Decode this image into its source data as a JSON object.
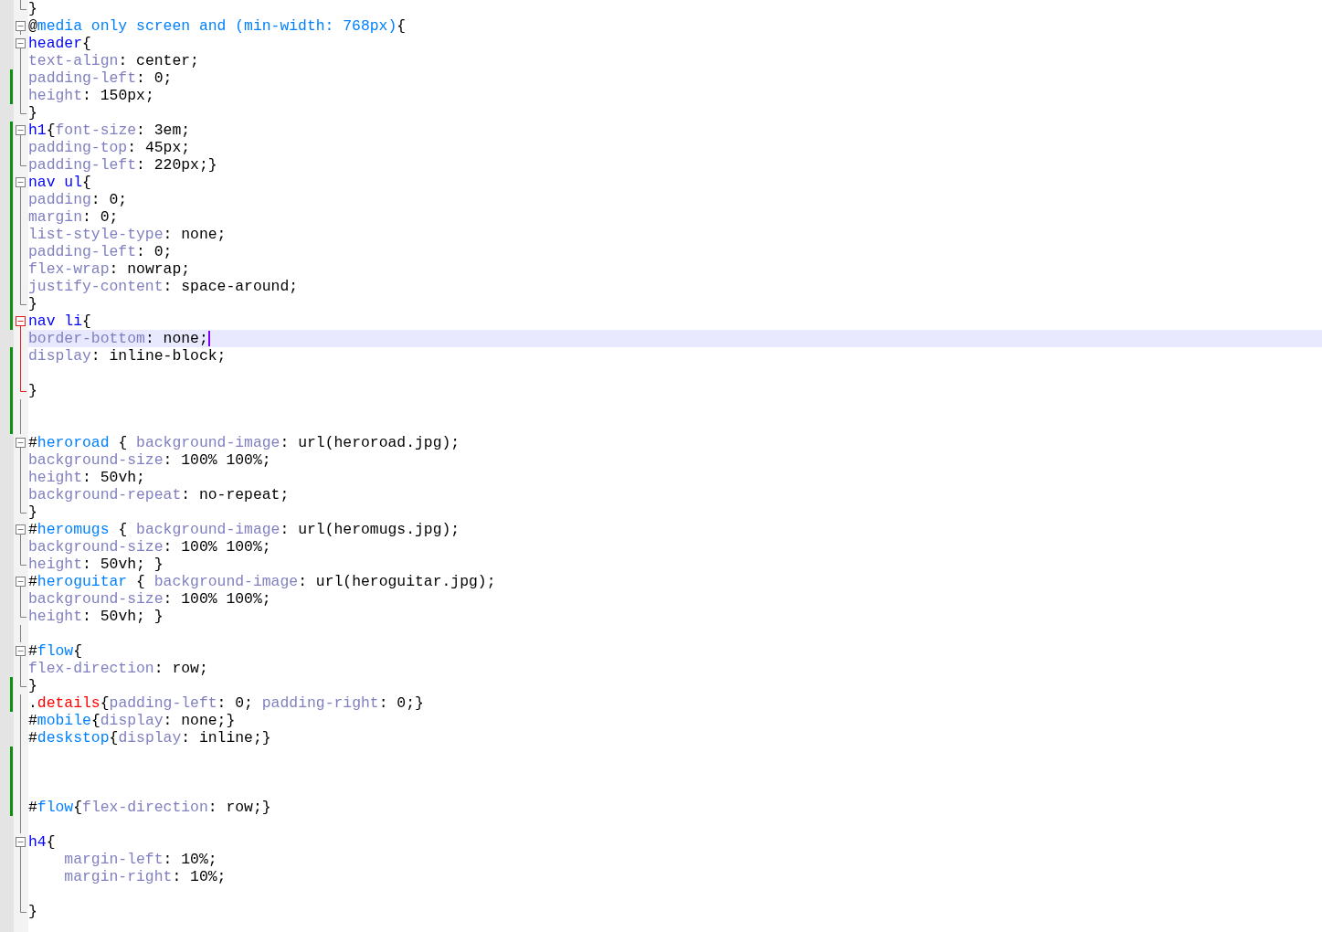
{
  "lines": [
    {
      "kind": "fold_end",
      "indented": false,
      "changed": false,
      "active_block": false,
      "current": false,
      "tokens": [
        {
          "text": "}",
          "kind": "punct"
        }
      ]
    },
    {
      "kind": "fold_start",
      "indented": false,
      "changed": false,
      "active_block": false,
      "current": false,
      "tokens": [
        {
          "text": "@",
          "kind": "punct"
        },
        {
          "text": "media only screen and (min-width: 768px)",
          "kind": "at"
        },
        {
          "text": "{",
          "kind": "punct"
        }
      ]
    },
    {
      "kind": "fold_start",
      "indented": false,
      "changed": false,
      "active_block": false,
      "current": false,
      "tokens": [
        {
          "text": "header",
          "kind": "tag"
        },
        {
          "text": "{",
          "kind": "punct"
        }
      ]
    },
    {
      "kind": "plain",
      "indented": false,
      "changed": false,
      "active_block": false,
      "current": false,
      "tokens": [
        {
          "text": "text-align",
          "kind": "prop"
        },
        {
          "text": ": center;",
          "kind": "val"
        }
      ]
    },
    {
      "kind": "plain",
      "indented": false,
      "changed": true,
      "active_block": false,
      "current": false,
      "tokens": [
        {
          "text": "padding-left",
          "kind": "prop"
        },
        {
          "text": ": 0;",
          "kind": "val"
        }
      ]
    },
    {
      "kind": "plain",
      "indented": false,
      "changed": true,
      "active_block": false,
      "current": false,
      "tokens": [
        {
          "text": "height",
          "kind": "prop"
        },
        {
          "text": ": 150px;",
          "kind": "val"
        }
      ]
    },
    {
      "kind": "fold_end",
      "indented": false,
      "changed": false,
      "active_block": false,
      "current": false,
      "tokens": [
        {
          "text": "}",
          "kind": "punct"
        }
      ]
    },
    {
      "kind": "fold_start",
      "indented": false,
      "changed": true,
      "active_block": false,
      "current": false,
      "tokens": [
        {
          "text": "h1",
          "kind": "tag"
        },
        {
          "text": "{",
          "kind": "punct"
        },
        {
          "text": "font-size",
          "kind": "prop"
        },
        {
          "text": ": 3em;",
          "kind": "val"
        }
      ]
    },
    {
      "kind": "plain",
      "indented": false,
      "changed": true,
      "active_block": false,
      "current": false,
      "tokens": [
        {
          "text": "padding-top",
          "kind": "prop"
        },
        {
          "text": ": 45px;",
          "kind": "val"
        }
      ]
    },
    {
      "kind": "fold_end",
      "indented": false,
      "changed": true,
      "active_block": false,
      "current": false,
      "tokens": [
        {
          "text": "padding-left",
          "kind": "prop"
        },
        {
          "text": ": 220px;}",
          "kind": "val"
        }
      ]
    },
    {
      "kind": "fold_start",
      "indented": false,
      "changed": true,
      "active_block": false,
      "current": false,
      "tokens": [
        {
          "text": "nav ul",
          "kind": "tag"
        },
        {
          "text": "{",
          "kind": "punct"
        }
      ]
    },
    {
      "kind": "plain",
      "indented": false,
      "changed": true,
      "active_block": false,
      "current": false,
      "tokens": [
        {
          "text": "padding",
          "kind": "prop"
        },
        {
          "text": ": 0;",
          "kind": "val"
        }
      ]
    },
    {
      "kind": "plain",
      "indented": false,
      "changed": true,
      "active_block": false,
      "current": false,
      "tokens": [
        {
          "text": "margin",
          "kind": "prop"
        },
        {
          "text": ": 0;",
          "kind": "val"
        }
      ]
    },
    {
      "kind": "plain",
      "indented": false,
      "changed": true,
      "active_block": false,
      "current": false,
      "tokens": [
        {
          "text": "list-style-type",
          "kind": "prop"
        },
        {
          "text": ": none;",
          "kind": "val"
        }
      ]
    },
    {
      "kind": "plain",
      "indented": false,
      "changed": true,
      "active_block": false,
      "current": false,
      "tokens": [
        {
          "text": "padding-left",
          "kind": "prop"
        },
        {
          "text": ": 0;",
          "kind": "val"
        }
      ]
    },
    {
      "kind": "plain",
      "indented": false,
      "changed": true,
      "active_block": false,
      "current": false,
      "tokens": [
        {
          "text": "flex-wrap",
          "kind": "prop"
        },
        {
          "text": ": nowrap;",
          "kind": "val"
        }
      ]
    },
    {
      "kind": "plain",
      "indented": false,
      "changed": true,
      "active_block": false,
      "current": false,
      "tokens": [
        {
          "text": "justify-content",
          "kind": "prop"
        },
        {
          "text": ": space-around;",
          "kind": "val"
        }
      ]
    },
    {
      "kind": "fold_end",
      "indented": false,
      "changed": true,
      "active_block": false,
      "current": false,
      "tokens": [
        {
          "text": "}",
          "kind": "punct"
        }
      ]
    },
    {
      "kind": "fold_start",
      "indented": false,
      "changed": true,
      "active_block": true,
      "current": false,
      "tokens": [
        {
          "text": "nav li",
          "kind": "tag"
        },
        {
          "text": "{",
          "kind": "punct"
        }
      ]
    },
    {
      "kind": "plain",
      "indented": false,
      "changed": false,
      "active_block": true,
      "current": true,
      "tokens": [
        {
          "text": "border-bottom",
          "kind": "prop"
        },
        {
          "text": ": none;",
          "kind": "val"
        }
      ]
    },
    {
      "kind": "plain",
      "indented": false,
      "changed": true,
      "active_block": true,
      "current": false,
      "tokens": [
        {
          "text": "display",
          "kind": "prop"
        },
        {
          "text": ": inline-block;",
          "kind": "val"
        }
      ]
    },
    {
      "kind": "plain",
      "indented": false,
      "changed": true,
      "active_block": true,
      "current": false
    },
    {
      "kind": "fold_end",
      "indented": false,
      "changed": true,
      "active_block": true,
      "current": false,
      "tokens": [
        {
          "text": "}",
          "kind": "punct"
        }
      ]
    },
    {
      "kind": "plain",
      "indented": false,
      "changed": true,
      "active_block": false,
      "current": false
    },
    {
      "kind": "plain",
      "indented": false,
      "changed": true,
      "active_block": false,
      "current": false
    },
    {
      "kind": "fold_start",
      "indented": false,
      "changed": false,
      "active_block": false,
      "current": false,
      "tokens": [
        {
          "text": "#",
          "kind": "punct"
        },
        {
          "text": "heroroad",
          "kind": "id"
        },
        {
          "text": " { ",
          "kind": "punct"
        },
        {
          "text": "background-image",
          "kind": "prop"
        },
        {
          "text": ": url(heroroad.jpg);",
          "kind": "val"
        }
      ]
    },
    {
      "kind": "plain",
      "indented": false,
      "changed": false,
      "active_block": false,
      "current": false,
      "tokens": [
        {
          "text": "background-size",
          "kind": "prop"
        },
        {
          "text": ": 100% 100%;",
          "kind": "val"
        }
      ]
    },
    {
      "kind": "plain",
      "indented": false,
      "changed": false,
      "active_block": false,
      "current": false,
      "tokens": [
        {
          "text": "height",
          "kind": "prop"
        },
        {
          "text": ": 50vh;",
          "kind": "val"
        }
      ]
    },
    {
      "kind": "plain",
      "indented": false,
      "changed": false,
      "active_block": false,
      "current": false,
      "tokens": [
        {
          "text": "background-repeat",
          "kind": "prop"
        },
        {
          "text": ": no-repeat;",
          "kind": "val"
        }
      ]
    },
    {
      "kind": "fold_end",
      "indented": false,
      "changed": false,
      "active_block": false,
      "current": false,
      "tokens": [
        {
          "text": "}",
          "kind": "punct"
        }
      ]
    },
    {
      "kind": "fold_start",
      "indented": false,
      "changed": false,
      "active_block": false,
      "current": false,
      "tokens": [
        {
          "text": "#",
          "kind": "punct"
        },
        {
          "text": "heromugs",
          "kind": "id"
        },
        {
          "text": " { ",
          "kind": "punct"
        },
        {
          "text": "background-image",
          "kind": "prop"
        },
        {
          "text": ": url(heromugs.jpg);",
          "kind": "val"
        }
      ]
    },
    {
      "kind": "plain",
      "indented": false,
      "changed": false,
      "active_block": false,
      "current": false,
      "tokens": [
        {
          "text": "background-size",
          "kind": "prop"
        },
        {
          "text": ": 100% 100%;",
          "kind": "val"
        }
      ]
    },
    {
      "kind": "fold_end",
      "indented": false,
      "changed": false,
      "active_block": false,
      "current": false,
      "tokens": [
        {
          "text": "height",
          "kind": "prop"
        },
        {
          "text": ": 50vh; }",
          "kind": "val"
        }
      ]
    },
    {
      "kind": "fold_start",
      "indented": false,
      "changed": false,
      "active_block": false,
      "current": false,
      "tokens": [
        {
          "text": "#",
          "kind": "punct"
        },
        {
          "text": "heroguitar",
          "kind": "id"
        },
        {
          "text": " { ",
          "kind": "punct"
        },
        {
          "text": "background-image",
          "kind": "prop"
        },
        {
          "text": ": url(heroguitar.jpg);",
          "kind": "val"
        }
      ]
    },
    {
      "kind": "plain",
      "indented": false,
      "changed": false,
      "active_block": false,
      "current": false,
      "tokens": [
        {
          "text": "background-size",
          "kind": "prop"
        },
        {
          "text": ": 100% 100%;",
          "kind": "val"
        }
      ]
    },
    {
      "kind": "fold_end",
      "indented": false,
      "changed": false,
      "active_block": false,
      "current": false,
      "tokens": [
        {
          "text": "height",
          "kind": "prop"
        },
        {
          "text": ": 50vh; }",
          "kind": "val"
        }
      ]
    },
    {
      "kind": "plain",
      "indented": false,
      "changed": false,
      "active_block": false,
      "current": false
    },
    {
      "kind": "fold_start",
      "indented": false,
      "changed": false,
      "active_block": false,
      "current": false,
      "tokens": [
        {
          "text": "#",
          "kind": "punct"
        },
        {
          "text": "flow",
          "kind": "id"
        },
        {
          "text": "{",
          "kind": "punct"
        }
      ]
    },
    {
      "kind": "plain",
      "indented": false,
      "changed": false,
      "active_block": false,
      "current": false,
      "tokens": [
        {
          "text": "flex-direction",
          "kind": "prop"
        },
        {
          "text": ": row;",
          "kind": "val"
        }
      ]
    },
    {
      "kind": "fold_end",
      "indented": false,
      "changed": true,
      "active_block": false,
      "current": false,
      "tokens": [
        {
          "text": "}",
          "kind": "punct"
        }
      ]
    },
    {
      "kind": "plain",
      "indented": false,
      "changed": true,
      "active_block": false,
      "current": false,
      "tokens": [
        {
          "text": ".",
          "kind": "punct"
        },
        {
          "text": "details",
          "kind": "class"
        },
        {
          "text": "{",
          "kind": "punct"
        },
        {
          "text": "padding-left",
          "kind": "prop"
        },
        {
          "text": ": 0; ",
          "kind": "val"
        },
        {
          "text": "padding-right",
          "kind": "prop"
        },
        {
          "text": ": 0;}",
          "kind": "val"
        }
      ]
    },
    {
      "kind": "plain",
      "indented": false,
      "changed": false,
      "active_block": false,
      "current": false,
      "tokens": [
        {
          "text": "#",
          "kind": "punct"
        },
        {
          "text": "mobile",
          "kind": "id"
        },
        {
          "text": "{",
          "kind": "punct"
        },
        {
          "text": "display",
          "kind": "prop"
        },
        {
          "text": ": none;}",
          "kind": "val"
        }
      ]
    },
    {
      "kind": "plain",
      "indented": false,
      "changed": false,
      "active_block": false,
      "current": false,
      "tokens": [
        {
          "text": "#",
          "kind": "punct"
        },
        {
          "text": "deskstop",
          "kind": "id"
        },
        {
          "text": "{",
          "kind": "punct"
        },
        {
          "text": "display",
          "kind": "prop"
        },
        {
          "text": ": inline;}",
          "kind": "val"
        }
      ]
    },
    {
      "kind": "plain",
      "indented": false,
      "changed": true,
      "active_block": false,
      "current": false
    },
    {
      "kind": "plain",
      "indented": false,
      "changed": true,
      "active_block": false,
      "current": false
    },
    {
      "kind": "plain",
      "indented": false,
      "changed": true,
      "active_block": false,
      "current": false
    },
    {
      "kind": "plain",
      "indented": false,
      "changed": true,
      "active_block": false,
      "current": false,
      "tokens": [
        {
          "text": "#",
          "kind": "punct"
        },
        {
          "text": "flow",
          "kind": "id"
        },
        {
          "text": "{",
          "kind": "punct"
        },
        {
          "text": "flex-direction",
          "kind": "prop"
        },
        {
          "text": ": row;}",
          "kind": "val"
        }
      ]
    },
    {
      "kind": "plain",
      "indented": false,
      "changed": false,
      "active_block": false,
      "current": false
    },
    {
      "kind": "fold_start",
      "indented": false,
      "changed": false,
      "active_block": false,
      "current": false,
      "tokens": [
        {
          "text": "h4",
          "kind": "tag"
        },
        {
          "text": "{",
          "kind": "punct"
        }
      ]
    },
    {
      "kind": "plain",
      "indented": true,
      "changed": false,
      "active_block": false,
      "current": false,
      "tokens": [
        {
          "text": "margin-left",
          "kind": "prop"
        },
        {
          "text": ": 10%;",
          "kind": "val"
        }
      ]
    },
    {
      "kind": "plain",
      "indented": true,
      "changed": false,
      "active_block": false,
      "current": false,
      "tokens": [
        {
          "text": "margin-right",
          "kind": "prop"
        },
        {
          "text": ": 10%;",
          "kind": "val"
        }
      ]
    },
    {
      "kind": "plain",
      "indented": false,
      "changed": false,
      "active_block": false,
      "current": false
    },
    {
      "kind": "fold_end",
      "indented": false,
      "changed": false,
      "active_block": false,
      "current": false,
      "tokens": [
        {
          "text": "}",
          "kind": "punct"
        }
      ]
    }
  ]
}
